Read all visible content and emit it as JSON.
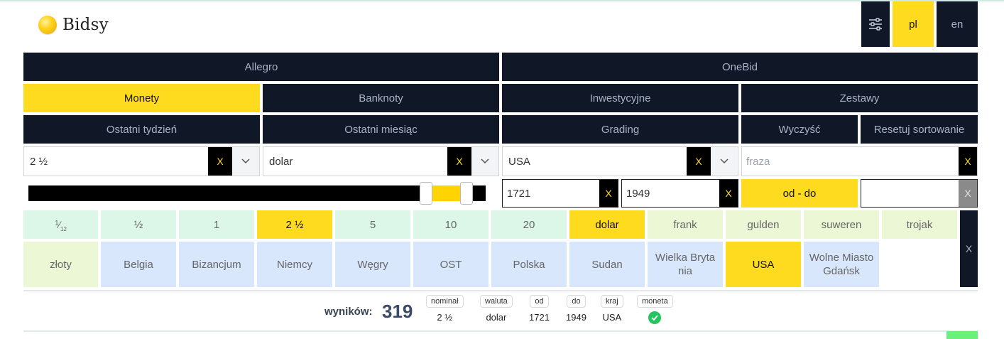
{
  "brand": {
    "name": "Bidsy"
  },
  "header": {
    "settings_icon": "sliders-icon",
    "lang_pl": "pl",
    "lang_en": "en"
  },
  "sources": {
    "allegro": "Allegro",
    "onebid": "OneBid"
  },
  "categories": {
    "monety": "Monety",
    "banknoty": "Banknoty",
    "inwestycyjne": "Inwestycyjne",
    "zestawy": "Zestawy"
  },
  "periods": {
    "last_week": "Ostatni tydzień",
    "last_month": "Ostatni miesiąc",
    "grading": "Grading",
    "clear": "Wyczyść",
    "reset_sort": "Resetuj sortowanie"
  },
  "filters": {
    "denomination": {
      "value": "2 ½",
      "clear": "X"
    },
    "currency": {
      "value": "dolar",
      "clear": "X"
    },
    "country": {
      "value": "USA",
      "clear": "X"
    },
    "phrase": {
      "placeholder": "fraza",
      "clear": "X"
    },
    "year_from": {
      "value": "1721",
      "clear": "X"
    },
    "year_to": {
      "value": "1949",
      "clear": "X"
    },
    "range_button": "od - do",
    "extra": {
      "value": "",
      "clear": "X"
    }
  },
  "chips": {
    "fraction": {
      "num": "1",
      "den": "12"
    },
    "nominals": [
      "½",
      "1",
      "2 ½",
      "5",
      "10",
      "20"
    ],
    "currencies": [
      "dolar",
      "frank",
      "gulden",
      "suweren",
      "trojak",
      "złoty"
    ],
    "countries": [
      "Belgia",
      "Bizancjum",
      "Niemcy",
      "Węgry",
      "OST",
      "Polska",
      "Sudan",
      "Wielka Bryta nia",
      "USA",
      "Wolne Miasto Gdańsk"
    ],
    "clear_all": "X"
  },
  "results": {
    "label": "wyników:",
    "count": "319",
    "summary": [
      {
        "tag": "nominał",
        "value": "2 ½"
      },
      {
        "tag": "waluta",
        "value": "dolar"
      },
      {
        "tag": "od",
        "value": "1721"
      },
      {
        "tag": "do",
        "value": "1949"
      },
      {
        "tag": "kraj",
        "value": "USA"
      },
      {
        "tag": "moneta",
        "value": ""
      }
    ]
  },
  "colors": {
    "dark": "#101828",
    "accent": "#ffdb1f",
    "green": "#22c55e"
  }
}
